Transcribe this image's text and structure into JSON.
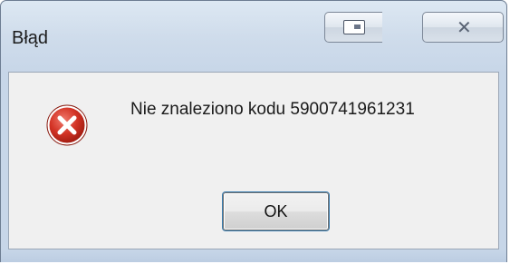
{
  "window": {
    "title": "Błąd",
    "close_glyph": "✕"
  },
  "dialog": {
    "icon": "error-icon",
    "message": "Nie znaleziono kodu 5900741961231",
    "ok_label": "OK"
  },
  "colors": {
    "frame": "#cfdceb",
    "client": "#f0f0f0",
    "error_red": "#c8261c",
    "focus_ring": "#3c7fb1"
  }
}
